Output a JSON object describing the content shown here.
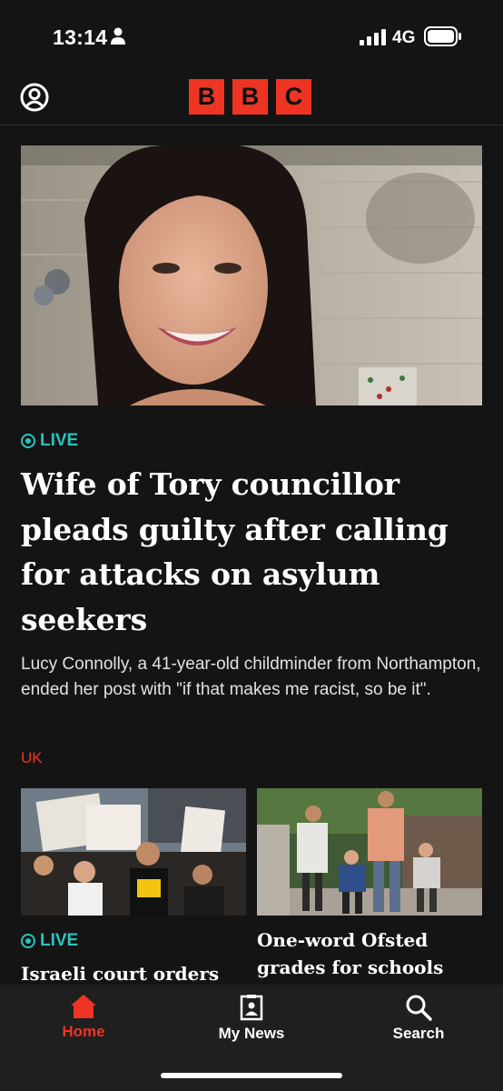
{
  "status_bar": {
    "time": "13:14",
    "network": "4G"
  },
  "header": {
    "logo_letters": [
      "B",
      "B",
      "C"
    ],
    "logo_color": "#ee3423"
  },
  "hero": {
    "badge": "LIVE",
    "headline": "Wife of Tory councillor pleads guilty after calling for attacks on asylum seekers",
    "summary": "Lucy Connolly, a 41-year-old childminder from Northampton, ended her post with \"if that makes me racist, so be it\".",
    "topic": "UK"
  },
  "cards": [
    {
      "badge": "LIVE",
      "headline": "Israeli court orders"
    },
    {
      "badge": "",
      "headline": "One-word Ofsted grades for schools"
    }
  ],
  "tab_bar": {
    "items": [
      {
        "label": "Home",
        "icon": "home-icon",
        "active": true
      },
      {
        "label": "My News",
        "icon": "my-news-icon",
        "active": false
      },
      {
        "label": "Search",
        "icon": "search-icon",
        "active": false
      }
    ]
  },
  "colors": {
    "background": "#141414",
    "accent": "#ee3423",
    "live": "#2bc4bd",
    "tab_bar": "#1f1f1f"
  }
}
